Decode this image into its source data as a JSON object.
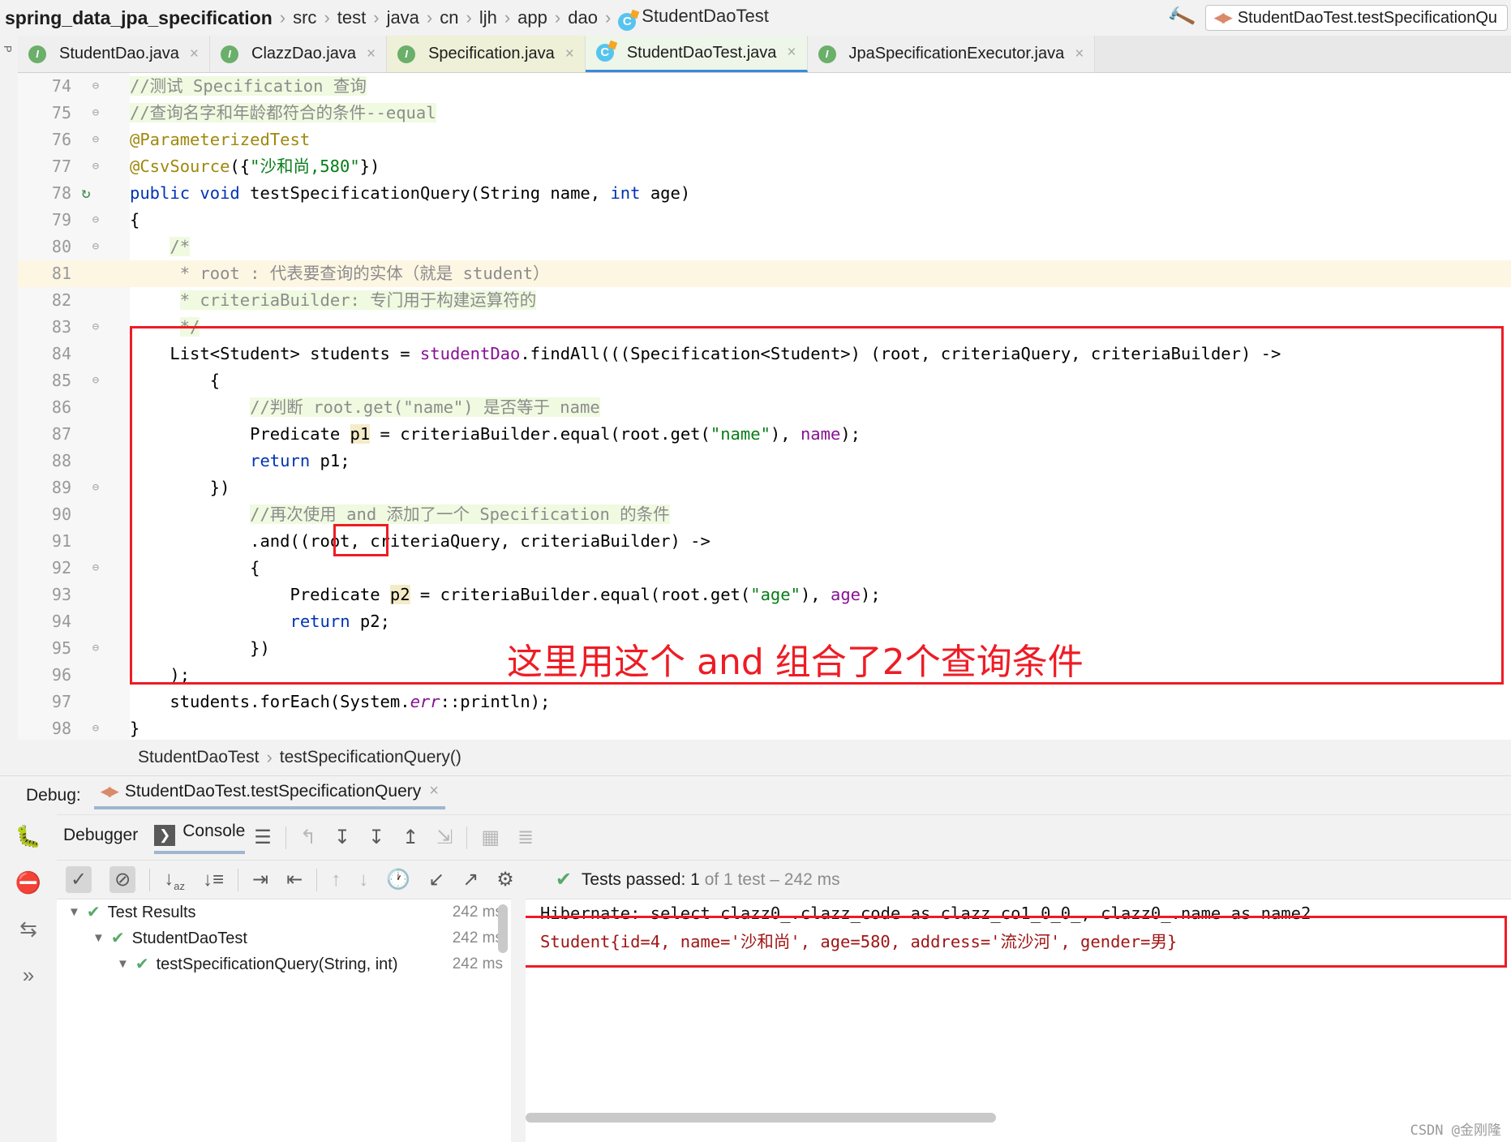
{
  "navbar": {
    "breadcrumbs": [
      {
        "label": "spring_data_jpa_specification",
        "bold": true
      },
      {
        "label": "src"
      },
      {
        "label": "test"
      },
      {
        "label": "java"
      },
      {
        "label": "cn"
      },
      {
        "label": "ljh"
      },
      {
        "label": "app"
      },
      {
        "label": "dao"
      },
      {
        "label": "StudentDaoTest",
        "icon": "class-icon"
      }
    ],
    "separator": "›",
    "build_icon": "hammer-icon",
    "run_config": {
      "icon": "run-config-icon",
      "label": "StudentDaoTest.testSpecificationQu"
    }
  },
  "tabs": [
    {
      "label": "StudentDao.java",
      "icon": "interface-icon",
      "state": "plain"
    },
    {
      "label": "ClazzDao.java",
      "icon": "interface-icon",
      "state": "plain"
    },
    {
      "label": "Specification.java",
      "icon": "interface-icon",
      "state": "yellow"
    },
    {
      "label": "StudentDaoTest.java",
      "icon": "class-icon",
      "state": "active"
    },
    {
      "label": "JpaSpecificationExecutor.java",
      "icon": "interface-icon",
      "state": "plain"
    }
  ],
  "close_glyph": "×",
  "editor": {
    "lines": [
      {
        "num": "74",
        "fold": "⊖",
        "html": "<span class=\"hl-green\"><span class=\"cmt\">//测试 Specification 查询</span></span>",
        "bg": "none"
      },
      {
        "num": "75",
        "fold": "⊖",
        "html": "<span class=\"hl-green\"><span class=\"cmt\">//查询名字和年龄都符合的条件--equal</span></span>",
        "bg": "none"
      },
      {
        "num": "76",
        "fold": "⊖",
        "html": "<span class=\"ann\">@ParameterizedTest</span>",
        "bg": "none"
      },
      {
        "num": "77",
        "fold": "⊖",
        "html": "<span class=\"ann\">@CsvSource</span>({<span class=\"str\">\"沙和尚,580\"</span>})",
        "bg": "none"
      },
      {
        "num": "78",
        "fold": "",
        "gutter_icon": "rerun-test-icon",
        "html": "<span class=\"kw\">public</span> <span class=\"kw\">void</span> <span class=\"ident\">testSpecificationQuery</span>(String name, <span class=\"kw\">int</span> age)",
        "bg": "none"
      },
      {
        "num": "79",
        "fold": "⊖",
        "html": "{",
        "bg": "none"
      },
      {
        "num": "80",
        "fold": "⊖",
        "html": "    <span class=\"hl-green\"><span class=\"cmt\">/*</span></span>",
        "bg": "none"
      },
      {
        "num": "81",
        "fold": "",
        "html": "     <span class=\"cmt\">* root : 代表要查询的实体（就是 student）</span>",
        "bg": "yellow"
      },
      {
        "num": "82",
        "fold": "",
        "html": "     <span class=\"hl-green\"><span class=\"cmt\">* criteriaBuilder: 专门用于构建运算符的</span></span>",
        "bg": "none"
      },
      {
        "num": "83",
        "fold": "⊖",
        "html": "     <span class=\"hl-green\"><span class=\"cmt\">*/</span></span>",
        "bg": "none"
      },
      {
        "num": "84",
        "fold": "",
        "html": "    List&lt;Student&gt; students = <span class=\"fld\">studentDao</span>.findAll(((Specification&lt;Student&gt;) (root, criteriaQuery, criteriaBuilder) -&gt;",
        "bg": "none"
      },
      {
        "num": "85",
        "fold": "⊖",
        "html": "        {",
        "bg": "none"
      },
      {
        "num": "86",
        "fold": "",
        "html": "            <span class=\"hl-green\"><span class=\"cmt\">//判断 root.get(\"name\") 是否等于 name</span></span>",
        "bg": "none"
      },
      {
        "num": "87",
        "fold": "",
        "html": "            Predicate <span class=\"hl-ident\">p1</span> = criteriaBuilder.equal(root.get(<span class=\"str\">\"name\"</span>), <span class=\"fld\">name</span>);",
        "bg": "none"
      },
      {
        "num": "88",
        "fold": "",
        "html": "            <span class=\"kw\">return</span> p1;",
        "bg": "none"
      },
      {
        "num": "89",
        "fold": "⊖",
        "html": "        })",
        "bg": "none"
      },
      {
        "num": "90",
        "fold": "",
        "html": "            <span class=\"hl-green\"><span class=\"cmt\">//再次使用 and 添加了一个 Specification 的条件</span></span>",
        "bg": "none"
      },
      {
        "num": "91",
        "fold": "",
        "html": "            .and((root, criteriaQuery, criteriaBuilder) -&gt;",
        "bg": "none"
      },
      {
        "num": "92",
        "fold": "⊖",
        "html": "            {",
        "bg": "none"
      },
      {
        "num": "93",
        "fold": "",
        "html": "                Predicate <span class=\"hl-ident\">p2</span> = criteriaBuilder.equal(root.get(<span class=\"str\">\"age\"</span>), <span class=\"fld\">age</span>);",
        "bg": "none"
      },
      {
        "num": "94",
        "fold": "",
        "html": "                <span class=\"kw\">return</span> p2;",
        "bg": "none"
      },
      {
        "num": "95",
        "fold": "⊖",
        "html": "            })",
        "bg": "none"
      },
      {
        "num": "96",
        "fold": "",
        "html": "    );",
        "bg": "none"
      },
      {
        "num": "97",
        "fold": "",
        "html": "    students.forEach(System.<span class=\"sfld\">err</span>::println);",
        "bg": "none"
      },
      {
        "num": "98",
        "fold": "⊖",
        "html": "}",
        "bg": "none"
      }
    ],
    "annotation_text": "这里用这个 and 组合了2个查询条件",
    "annotation_color": "#ee1c25"
  },
  "editor_breadcrumb": {
    "class": "StudentDaoTest",
    "separator": "›",
    "method": "testSpecificationQuery()"
  },
  "debug": {
    "label": "Debug:",
    "session": "StudentDaoTest.testSpecificationQuery",
    "tabs": [
      {
        "label": "Debugger",
        "active": false
      },
      {
        "label": "Console",
        "active": true,
        "icon": "console-icon"
      }
    ],
    "toolbar_icons": [
      "layout-icon",
      "step-over-icon",
      "step-into-icon",
      "force-step-into-icon",
      "step-out-icon",
      "run-to-cursor-icon",
      "evaluate-icon",
      "settings-icon"
    ],
    "side_icons": [
      "bug-icon",
      "mute-breakpoints-icon",
      "restore-layout-icon",
      "more-icon"
    ],
    "test_toolbar_icons": [
      "show-passed-icon",
      "show-ignored-icon",
      "sort-alphabetically-icon",
      "sort-by-duration-icon",
      "expand-all-icon",
      "collapse-all-icon",
      "prev-failed-icon",
      "next-failed-icon",
      "history-icon",
      "import-results-icon",
      "export-results-icon",
      "test-settings-icon"
    ],
    "status": {
      "check": "✔",
      "prefix": "Tests passed:",
      "count": "1",
      "suffix": "of 1 test – 242 ms"
    },
    "tree": [
      {
        "label": "Test Results",
        "time": "242 ms",
        "indent": 0,
        "expanded": true
      },
      {
        "label": "StudentDaoTest",
        "time": "242 ms",
        "indent": 1,
        "expanded": true
      },
      {
        "label": "testSpecificationQuery(String, int)",
        "time": "242 ms",
        "indent": 2,
        "expanded": true
      }
    ],
    "console_lines": [
      {
        "text": "Hibernate: select clazz0_.clazz_code as clazz_co1_0_0_, clazz0_.name as name2",
        "type": "hibernate"
      },
      {
        "text": "Student{id=4, name='沙和尚', age=580, address='流沙河', gender=男}",
        "type": "stderr"
      }
    ]
  },
  "watermark": "CSDN @金刚隆",
  "colors": {
    "accent_blue": "#3c8ad8",
    "annotation_red": "#ee1c25",
    "pass_green": "#59a869",
    "comment_grey": "#8c8c8c",
    "keyword_blue": "#0033b3",
    "string_green": "#067d17",
    "field_purple": "#871094",
    "annotation_gold": "#9e880d",
    "stderr_red": "#a01515"
  }
}
